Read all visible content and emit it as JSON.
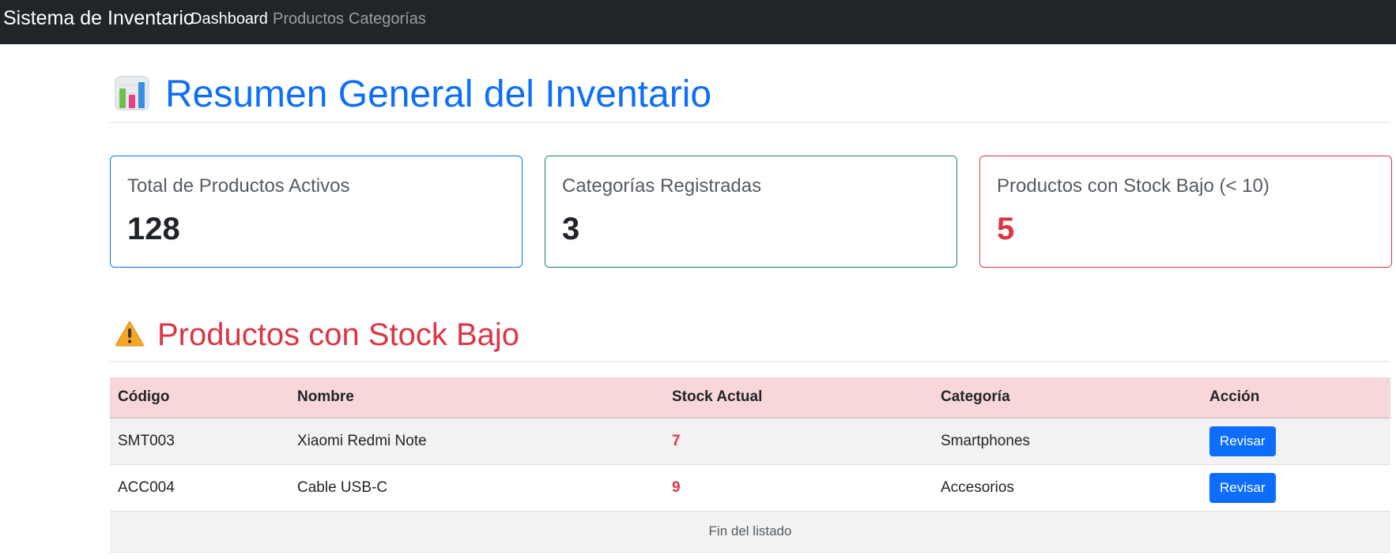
{
  "navbar": {
    "brand": "Sistema de Inventario",
    "links": [
      {
        "label": "Dashboard",
        "active": true
      },
      {
        "label": "Productos",
        "active": false
      },
      {
        "label": "Categorías",
        "active": false
      }
    ]
  },
  "header": {
    "icon": "bar-chart-icon",
    "title": "Resumen General del Inventario"
  },
  "cards": [
    {
      "title": "Total de Productos Activos",
      "value": "128",
      "border_color": "#0d6efd"
    },
    {
      "title": "Categorías Registradas",
      "value": "3",
      "border_color": "#198754"
    },
    {
      "title": "Productos con Stock Bajo (< 10)",
      "value": "5",
      "border_color": "#dc3545"
    }
  ],
  "low_stock": {
    "icon": "warning-icon",
    "title": "Productos con Stock Bajo",
    "columns": [
      "Código",
      "Nombre",
      "Stock Actual",
      "Categoría",
      "Acción"
    ],
    "rows": [
      {
        "code": "SMT003",
        "name": "Xiaomi Redmi Note",
        "stock": "7",
        "category": "Smartphones",
        "action": "Revisar"
      },
      {
        "code": "ACC004",
        "name": "Cable USB-C",
        "stock": "9",
        "category": "Accesorios",
        "action": "Revisar"
      }
    ],
    "footer": "Fin del listado"
  },
  "colors": {
    "primary": "#0d6efd",
    "success": "#198754",
    "danger": "#dc3545",
    "navbar": "#212529"
  }
}
